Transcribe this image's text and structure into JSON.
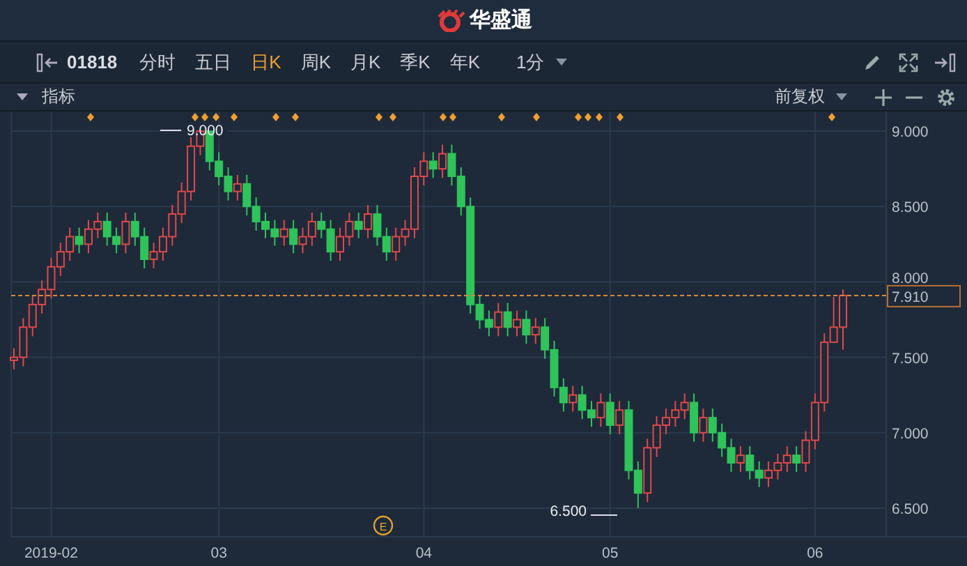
{
  "header": {
    "title": "华盛通"
  },
  "toolbar": {
    "symbol": "01818",
    "interval": "1分",
    "periods": [
      {
        "label": "分时",
        "selected": false
      },
      {
        "label": "五日",
        "selected": false
      },
      {
        "label": "日K",
        "selected": true
      },
      {
        "label": "周K",
        "selected": false
      },
      {
        "label": "月K",
        "selected": false
      },
      {
        "label": "季K",
        "selected": false
      },
      {
        "label": "年K",
        "selected": false
      }
    ]
  },
  "indicator_bar": {
    "label": "指标",
    "adjustment": "前复权"
  },
  "chart": {
    "high_label": "9.000",
    "low_label": "6.500",
    "event_label": "E",
    "chart_data": {
      "type": "candlestick",
      "categories": [
        null,
        null,
        null,
        null,
        "2019-02",
        null,
        null,
        null,
        null,
        null,
        null,
        null,
        null,
        null,
        null,
        null,
        null,
        null,
        null,
        null,
        null,
        null,
        "03",
        null,
        null,
        null,
        null,
        null,
        null,
        null,
        null,
        null,
        null,
        null,
        null,
        null,
        null,
        null,
        null,
        null,
        null,
        null,
        null,
        null,
        "04",
        null,
        null,
        null,
        null,
        null,
        null,
        null,
        null,
        null,
        null,
        null,
        null,
        null,
        null,
        null,
        null,
        null,
        null,
        null,
        "05",
        null,
        null,
        null,
        null,
        null,
        null,
        null,
        null,
        null,
        null,
        null,
        null,
        null,
        null,
        null,
        null,
        null,
        null,
        null,
        null,
        null,
        "06",
        null,
        null,
        null
      ],
      "ylim": [
        6.31,
        9.13
      ],
      "grid": true,
      "ref_lines": [
        {
          "axis": "y",
          "value": 7.91,
          "label": "7.910"
        }
      ],
      "ohlc": [
        [
          7.48,
          7.56,
          7.42,
          7.5
        ],
        [
          7.5,
          7.76,
          7.44,
          7.7
        ],
        [
          7.7,
          7.91,
          7.64,
          7.85
        ],
        [
          7.85,
          8.01,
          7.79,
          7.95
        ],
        [
          7.95,
          8.16,
          7.89,
          8.1
        ],
        [
          8.1,
          8.26,
          8.04,
          8.2
        ],
        [
          8.2,
          8.36,
          8.14,
          8.3
        ],
        [
          8.3,
          8.36,
          8.19,
          8.25
        ],
        [
          8.25,
          8.41,
          8.19,
          8.35
        ],
        [
          8.35,
          8.46,
          8.29,
          8.4
        ],
        [
          8.4,
          8.46,
          8.24,
          8.3
        ],
        [
          8.3,
          8.36,
          8.19,
          8.25
        ],
        [
          8.25,
          8.46,
          8.19,
          8.4
        ],
        [
          8.4,
          8.46,
          8.24,
          8.3
        ],
        [
          8.3,
          8.36,
          8.09,
          8.15
        ],
        [
          8.15,
          8.26,
          8.09,
          8.2
        ],
        [
          8.2,
          8.36,
          8.14,
          8.3
        ],
        [
          8.3,
          8.51,
          8.24,
          8.45
        ],
        [
          8.45,
          8.66,
          8.39,
          8.6
        ],
        [
          8.6,
          8.96,
          8.54,
          8.9
        ],
        [
          8.9,
          9.0,
          8.84,
          9.0
        ],
        [
          9.0,
          9.0,
          8.74,
          8.8
        ],
        [
          8.8,
          8.86,
          8.64,
          8.7
        ],
        [
          8.7,
          8.76,
          8.54,
          8.6
        ],
        [
          8.6,
          8.71,
          8.54,
          8.65
        ],
        [
          8.65,
          8.71,
          8.44,
          8.5
        ],
        [
          8.5,
          8.56,
          8.34,
          8.4
        ],
        [
          8.4,
          8.46,
          8.29,
          8.35
        ],
        [
          8.35,
          8.41,
          8.24,
          8.3
        ],
        [
          8.3,
          8.41,
          8.24,
          8.35
        ],
        [
          8.35,
          8.41,
          8.19,
          8.25
        ],
        [
          8.25,
          8.36,
          8.19,
          8.3
        ],
        [
          8.3,
          8.46,
          8.24,
          8.4
        ],
        [
          8.4,
          8.46,
          8.29,
          8.35
        ],
        [
          8.35,
          8.41,
          8.14,
          8.2
        ],
        [
          8.2,
          8.36,
          8.14,
          8.3
        ],
        [
          8.3,
          8.46,
          8.24,
          8.4
        ],
        [
          8.4,
          8.46,
          8.29,
          8.35
        ],
        [
          8.35,
          8.51,
          8.29,
          8.45
        ],
        [
          8.45,
          8.51,
          8.24,
          8.3
        ],
        [
          8.3,
          8.36,
          8.14,
          8.2
        ],
        [
          8.2,
          8.36,
          8.14,
          8.3
        ],
        [
          8.3,
          8.41,
          8.24,
          8.35
        ],
        [
          8.35,
          8.76,
          8.29,
          8.7
        ],
        [
          8.7,
          8.86,
          8.64,
          8.8
        ],
        [
          8.8,
          8.86,
          8.69,
          8.75
        ],
        [
          8.75,
          8.91,
          8.69,
          8.85
        ],
        [
          8.85,
          8.91,
          8.64,
          8.7
        ],
        [
          8.7,
          8.76,
          8.44,
          8.5
        ],
        [
          8.5,
          8.56,
          7.79,
          7.85
        ],
        [
          7.85,
          7.91,
          7.69,
          7.75
        ],
        [
          7.75,
          7.81,
          7.64,
          7.7
        ],
        [
          7.7,
          7.86,
          7.64,
          7.8
        ],
        [
          7.8,
          7.86,
          7.64,
          7.7
        ],
        [
          7.7,
          7.81,
          7.64,
          7.75
        ],
        [
          7.75,
          7.81,
          7.59,
          7.65
        ],
        [
          7.65,
          7.76,
          7.59,
          7.7
        ],
        [
          7.7,
          7.76,
          7.49,
          7.55
        ],
        [
          7.55,
          7.61,
          7.24,
          7.3
        ],
        [
          7.3,
          7.36,
          7.14,
          7.2
        ],
        [
          7.2,
          7.31,
          7.14,
          7.25
        ],
        [
          7.25,
          7.31,
          7.09,
          7.15
        ],
        [
          7.15,
          7.21,
          7.04,
          7.1
        ],
        [
          7.1,
          7.26,
          7.04,
          7.2
        ],
        [
          7.2,
          7.26,
          6.99,
          7.05
        ],
        [
          7.05,
          7.21,
          6.99,
          7.15
        ],
        [
          7.15,
          7.21,
          6.69,
          6.75
        ],
        [
          6.75,
          6.81,
          6.5,
          6.6
        ],
        [
          6.6,
          6.96,
          6.54,
          6.9
        ],
        [
          6.9,
          7.11,
          6.84,
          7.05
        ],
        [
          7.05,
          7.16,
          6.99,
          7.1
        ],
        [
          7.1,
          7.21,
          7.04,
          7.15
        ],
        [
          7.15,
          7.26,
          7.09,
          7.2
        ],
        [
          7.2,
          7.26,
          6.94,
          7.0
        ],
        [
          7.0,
          7.16,
          6.94,
          7.1
        ],
        [
          7.1,
          7.16,
          6.94,
          7.0
        ],
        [
          7.0,
          7.06,
          6.84,
          6.9
        ],
        [
          6.9,
          6.96,
          6.74,
          6.8
        ],
        [
          6.8,
          6.91,
          6.74,
          6.85
        ],
        [
          6.85,
          6.91,
          6.69,
          6.75
        ],
        [
          6.75,
          6.81,
          6.64,
          6.7
        ],
        [
          6.7,
          6.81,
          6.64,
          6.75
        ],
        [
          6.75,
          6.86,
          6.69,
          6.8
        ],
        [
          6.8,
          6.91,
          6.74,
          6.85
        ],
        [
          6.85,
          6.91,
          6.74,
          6.8
        ],
        [
          6.8,
          7.01,
          6.74,
          6.95
        ],
        [
          6.95,
          7.26,
          6.89,
          7.2
        ],
        [
          7.2,
          7.66,
          7.14,
          7.6
        ],
        [
          7.6,
          7.9,
          7.6,
          7.7
        ],
        [
          7.7,
          7.95,
          7.55,
          7.91
        ]
      ],
      "yticks": [
        {
          "value": 9,
          "label": "9.000"
        },
        {
          "value": 8.5,
          "label": "8.500"
        },
        {
          "value": 8,
          "label": "8.000"
        },
        {
          "value": 7.5,
          "label": "7.500"
        },
        {
          "value": 7,
          "label": "7.000"
        },
        {
          "value": 6.5,
          "label": "6.500"
        }
      ]
    }
  }
}
